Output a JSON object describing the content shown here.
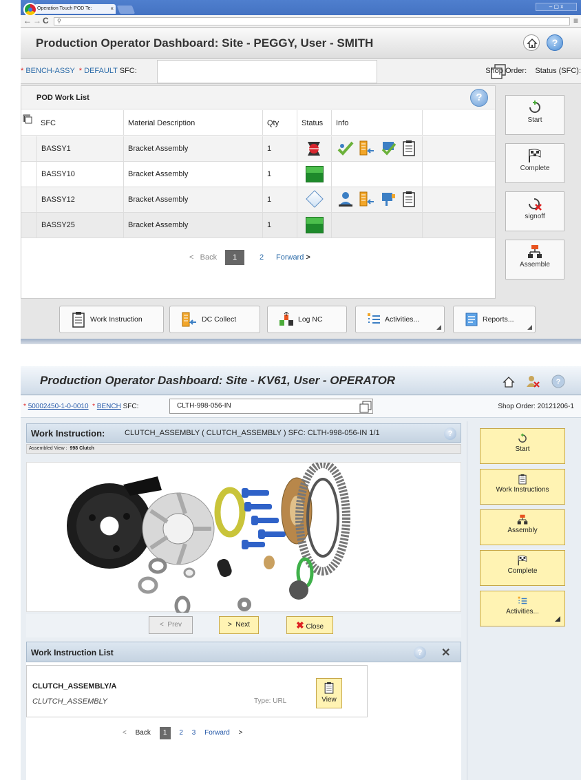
{
  "top": {
    "browser": {
      "tab_title": "Operation Touch POD Te:",
      "tab_close": "×",
      "window_controls": "–  ▢  x"
    },
    "header": {
      "title": "Production Operator Dashboard: Site - PEGGY, User - SMITH",
      "help": "?"
    },
    "sfc_bar": {
      "operation": "BENCH-ASSY",
      "resource": "DEFAULT",
      "sfc_label": "SFC:",
      "shop_order_label": "Shop Order:",
      "status_label": "Status (SFC):"
    },
    "work_list": {
      "title": "POD Work List",
      "help": "?",
      "columns": [
        "SFC",
        "Material Description",
        "Qty",
        "Status",
        "Info"
      ],
      "rows": [
        {
          "sfc": "BASSY1",
          "material": "Bracket Assembly",
          "qty": "1",
          "status": "stopped"
        },
        {
          "sfc": "BASSY10",
          "material": "Bracket Assembly",
          "qty": "1",
          "status": "active"
        },
        {
          "sfc": "BASSY12",
          "material": "Bracket Assembly",
          "qty": "1",
          "status": "queued"
        },
        {
          "sfc": "BASSY25",
          "material": "Bracket Assembly",
          "qty": "1",
          "status": "active"
        }
      ],
      "pager": {
        "back": "Back",
        "page1": "1",
        "page2": "2",
        "forward": "Forward"
      }
    },
    "sidebar": {
      "start": "Start",
      "complete": "Complete",
      "signoff": "signoff",
      "assemble": "Assemble"
    },
    "footer": {
      "work_instruction": "Work Instruction",
      "dc_collect": "DC Collect",
      "log_nc": "Log NC",
      "activities": "Activities...",
      "reports": "Reports..."
    }
  },
  "bottom": {
    "header": {
      "title": "Production Operator Dashboard: Site - KV61, User - OPERATOR"
    },
    "sfc_bar": {
      "operation": "50002450-1-0-0010",
      "resource": "BENCH",
      "sfc_label": "SFC:",
      "sfc_value": "CLTH-998-056-IN",
      "shop_order_label": "Shop Order:",
      "shop_order_value": "20121206-1"
    },
    "work_instruction": {
      "title": "Work Instruction:",
      "description": "CLUTCH_ASSEMBLY  ( CLUTCH_ASSEMBLY )  SFC: CLTH-998-056-IN  1/1",
      "assembled_label": "Assembled View :",
      "assembled_value": "998 Clutch",
      "prev": "Prev",
      "next": "Next",
      "close": "Close"
    },
    "work_instruction_list": {
      "title": "Work Instruction List",
      "item_name": "CLUTCH_ASSEMBLY/A",
      "item_sub": "CLUTCH_ASSEMBLY",
      "item_type": "Type: URL",
      "view": "View",
      "pager": {
        "back": "Back",
        "page1": "1",
        "page2": "2",
        "page3": "3",
        "forward": "Forward"
      }
    },
    "sidebar": {
      "start": "Start",
      "work_instructions": "Work Instructions",
      "assembly": "Assembly",
      "complete": "Complete",
      "activities": "Activities..."
    }
  }
}
